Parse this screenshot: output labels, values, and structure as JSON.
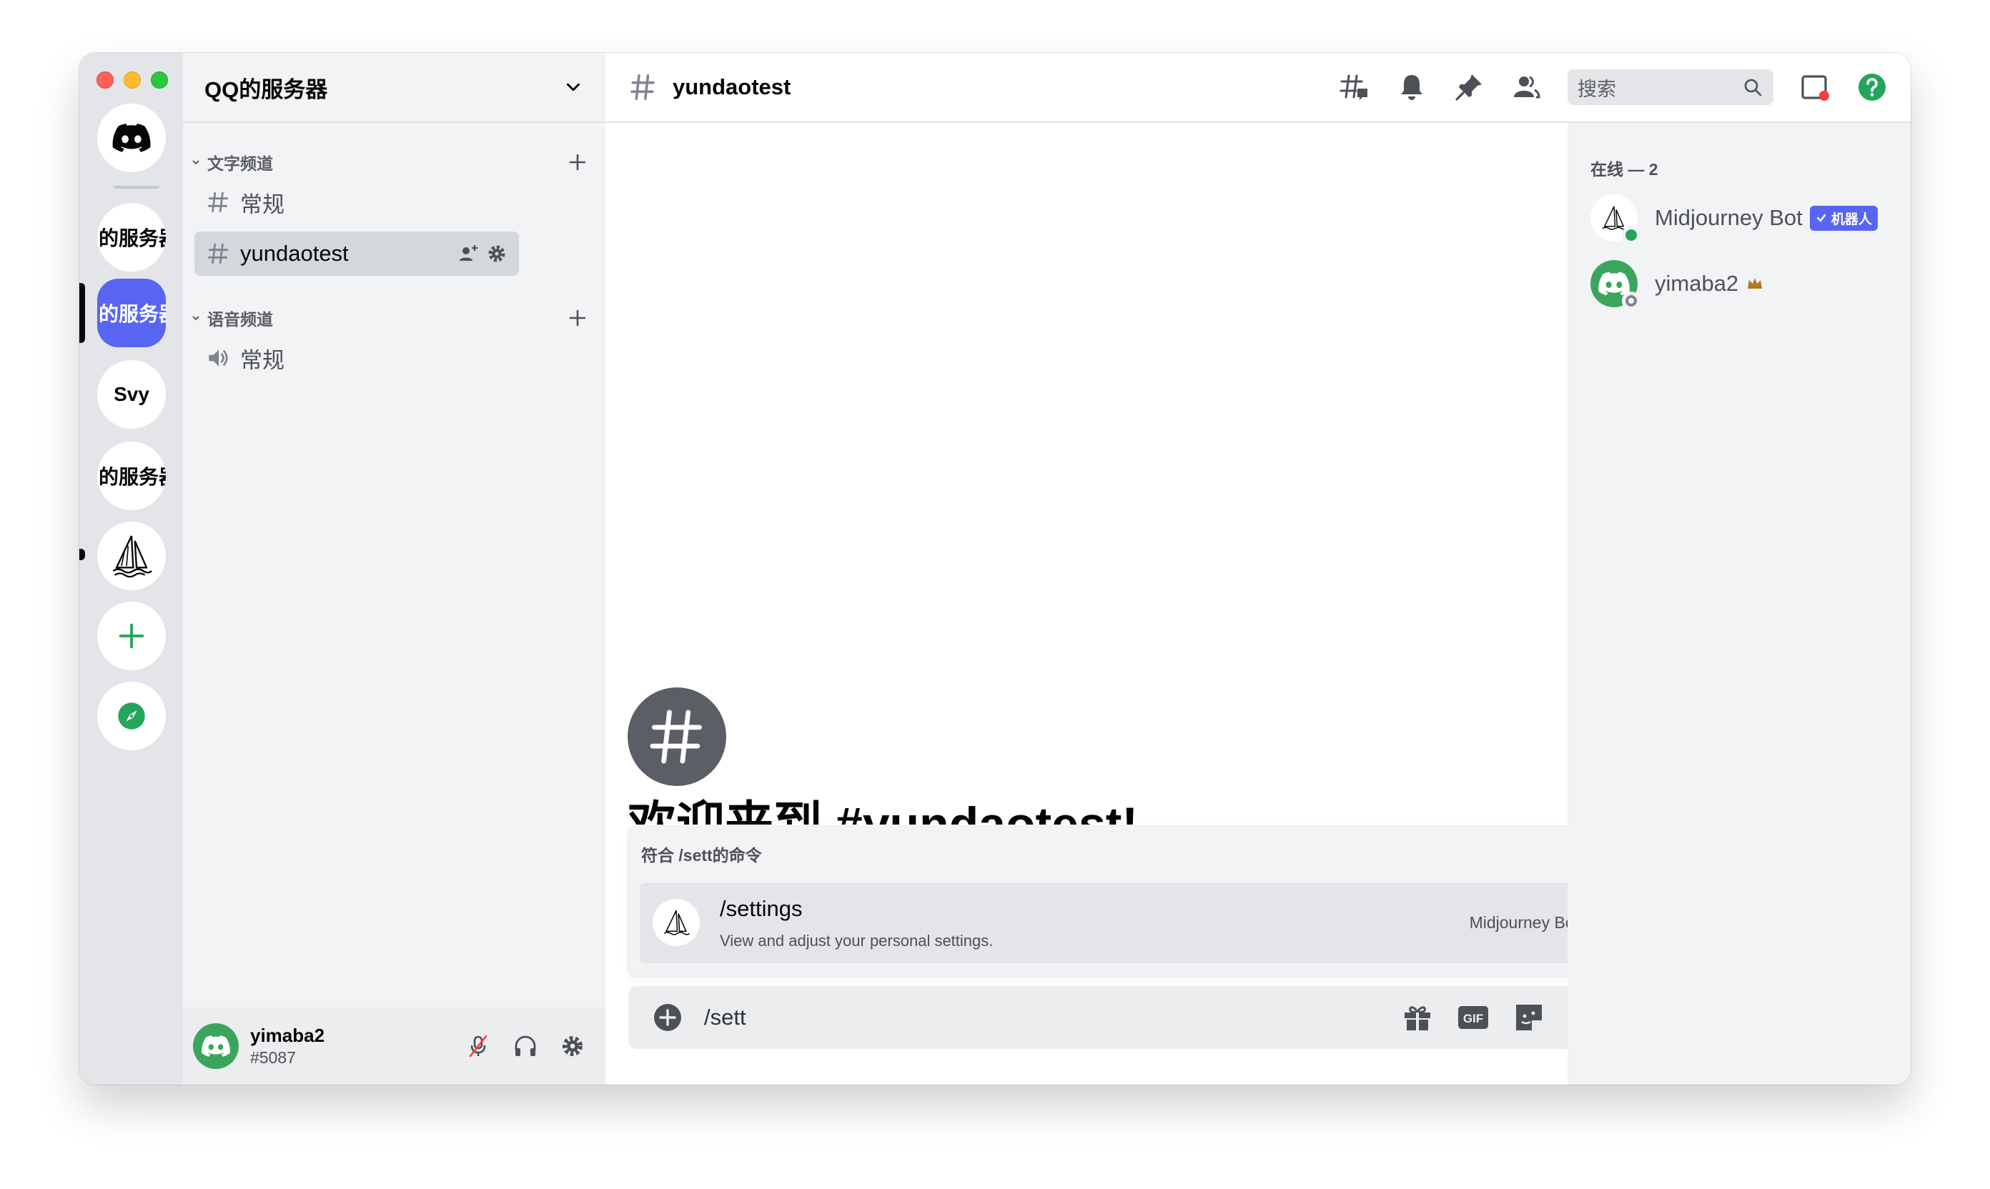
{
  "server_list": {
    "servers": [
      {
        "label": "的服务器"
      },
      {
        "label": "的服务器"
      },
      {
        "label": "Svy"
      },
      {
        "label": "的服务器"
      }
    ]
  },
  "guild": {
    "name": "QQ的服务器",
    "categories": {
      "text": "文字频道",
      "voice": "语音频道"
    },
    "text_channels": [
      {
        "label": "常规"
      },
      {
        "label": "yundaotest"
      }
    ],
    "voice_channels": [
      {
        "label": "常规"
      }
    ]
  },
  "user_panel": {
    "name": "yimaba2",
    "tag": "#5087"
  },
  "header": {
    "channel": "yundaotest",
    "search_placeholder": "搜索"
  },
  "chat": {
    "welcome": "欢迎来到 #yundaotest!"
  },
  "autocomplete": {
    "heading": "符合 /sett的命令",
    "command": "/settings",
    "description": "View and adjust your personal settings.",
    "source": "Midjourney Bot"
  },
  "composer": {
    "text": "/sett",
    "gif_label": "GIF"
  },
  "members": {
    "heading": "在线 — 2",
    "list": [
      {
        "name": "Midjourney Bot",
        "badge": "机器人",
        "status": "online"
      },
      {
        "name": "yimaba2",
        "status": "offline"
      }
    ]
  },
  "colors": {
    "blurple": "#5865f2",
    "green": "#3ba55d",
    "online": "#23a55a",
    "crown": "#b07a1e"
  }
}
